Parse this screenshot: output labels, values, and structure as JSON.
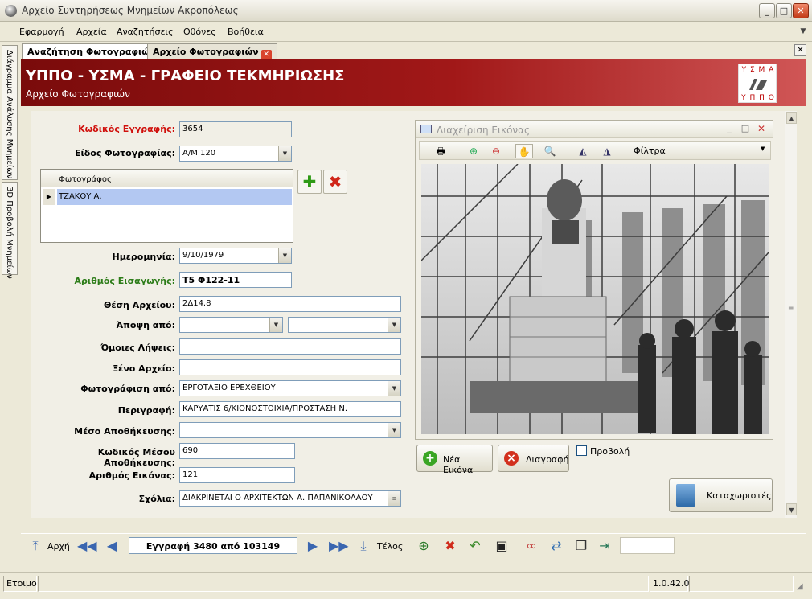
{
  "window": {
    "title": "Αρχείο Συντηρήσεως Μνημείων Ακροπόλεως",
    "min": "_",
    "max": "□",
    "close": "✕"
  },
  "menu": [
    "Εφαρμογή",
    "Αρχεία",
    "Αναζητήσεις",
    "Οθόνες",
    "Βοήθεια"
  ],
  "tabs": {
    "search": "Αναζήτηση Φωτογραφιών",
    "archive": "Αρχείο Φωτογραφιών"
  },
  "side_tabs": [
    "Διάγραμμα Ανάλυσης Μνημείων",
    "3D Προβολή Μνημείων"
  ],
  "banner": {
    "title": "ΥΠΠΟ - ΥΣΜΑ - ΓΡΑΦΕΙΟ ΤΕΚΜΗΡΙΩΣΗΣ",
    "subtitle": "Αρχείο Φωτογραφιών",
    "logo_top": "Υ Σ Μ Α",
    "logo_bottom": "Υ Π Π Ο"
  },
  "form": {
    "record_code": {
      "label": "Κωδικός Εγγραφής:",
      "value": "3654"
    },
    "photo_type": {
      "label": "Είδος Φωτογραφίας:",
      "value": "Α/Μ 120"
    },
    "photographer_grid": {
      "header": "Φωτογράφος",
      "rows": [
        "ΤΖΑΚΟΥ Α."
      ]
    },
    "date": {
      "label": "Ημερομηνία:",
      "value": "9/10/1979"
    },
    "entry_number": {
      "label": "Αριθμός Εισαγωγής:",
      "value": "Τ5 Φ122-11"
    },
    "archive_position": {
      "label": "Θέση Αρχείου:",
      "value": "2Δ14.8"
    },
    "view_from": {
      "label": "Άποψη από:",
      "value1": "",
      "value2": ""
    },
    "similar_shots": {
      "label": "Όμοιες Λήψεις:",
      "value": ""
    },
    "foreign_archive": {
      "label": "Ξένο Αρχείο:",
      "value": ""
    },
    "photographed_by": {
      "label": "Φωτογράφιση από:",
      "value": "ΕΡΓΟΤΑΞΙΟ ΕΡΕΧΘΕΙΟΥ"
    },
    "description": {
      "label": "Περιγραφή:",
      "value": "ΚΑΡΥΑΤΙΣ 6/ΚΙΟΝΟΣΤΟΙΧΙΑ/ΠΡΟΣΤΑΣΗ Ν."
    },
    "storage_medium": {
      "label": "Μέσο Αποθήκευσης:",
      "value": ""
    },
    "storage_medium_code": {
      "label": "Κωδικός Μέσου Αποθήκευσης:",
      "value": "690"
    },
    "image_number": {
      "label": "Αριθμός Εικόνας:",
      "value": "121"
    },
    "comments": {
      "label": "Σχόλια:",
      "value": "ΔΙΑΚΡΙΝΕΤΑΙ Ο ΑΡΧΙΤΕΚΤΩΝ  Α. ΠΑΠΑΝΙΚΟΛΑΟΥ"
    }
  },
  "image_panel": {
    "title": "Διαχείριση Εικόνας",
    "filters": "Φίλτρα"
  },
  "buttons": {
    "new_image": "Νέα Εικόνα",
    "delete": "Διαγραφή",
    "preview": "Προβολή",
    "catalogers": "Καταχωριστές"
  },
  "nav": {
    "first": "Αρχή",
    "last": "Τέλος",
    "record": "Εγγραφή 3480 από 103149"
  },
  "status": {
    "ready": "Ετοιμο",
    "version": "1.0.42.0"
  }
}
